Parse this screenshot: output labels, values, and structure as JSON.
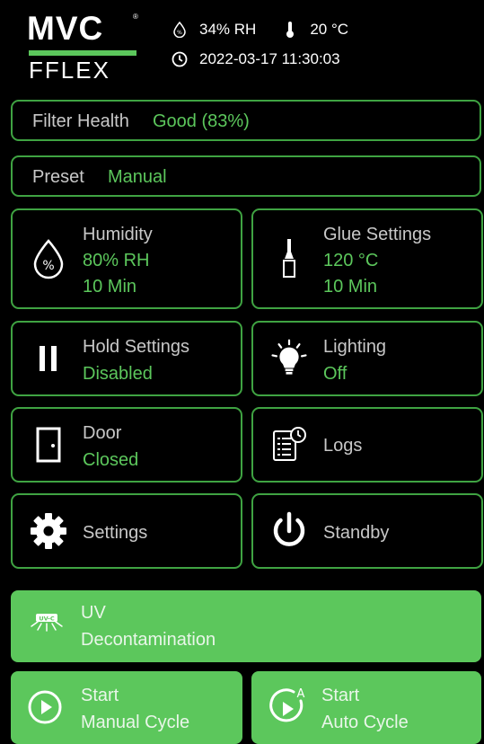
{
  "header": {
    "logo_top": "MVC",
    "logo_tm": "®",
    "logo_bottom": "FFLEX",
    "humidity": "34% RH",
    "temperature": "20 °C",
    "datetime": "2022-03-17 11:30:03"
  },
  "filter": {
    "label": "Filter Health",
    "value": "Good (83%)"
  },
  "preset": {
    "label": "Preset",
    "value": "Manual"
  },
  "tiles": {
    "humidity": {
      "title": "Humidity",
      "line1": "80% RH",
      "line2": "10 Min"
    },
    "glue": {
      "title": "Glue Settings",
      "line1": "120 °C",
      "line2": "10 Min"
    },
    "hold": {
      "title": "Hold Settings",
      "line1": "Disabled"
    },
    "lighting": {
      "title": "Lighting",
      "line1": "Off"
    },
    "door": {
      "title": "Door",
      "line1": "Closed"
    },
    "logs": {
      "title": "Logs"
    },
    "settings": {
      "title": "Settings"
    },
    "standby": {
      "title": "Standby"
    }
  },
  "uv": {
    "badge": "UV-C",
    "line1": "UV",
    "line2": "Decontamination"
  },
  "manual": {
    "line1": "Start",
    "line2": "Manual Cycle"
  },
  "auto": {
    "badge": "A",
    "line1": "Start",
    "line2": "Auto Cycle"
  },
  "colors": {
    "accent": "#5cc75c",
    "border": "#3fa342",
    "background": "#000000"
  }
}
